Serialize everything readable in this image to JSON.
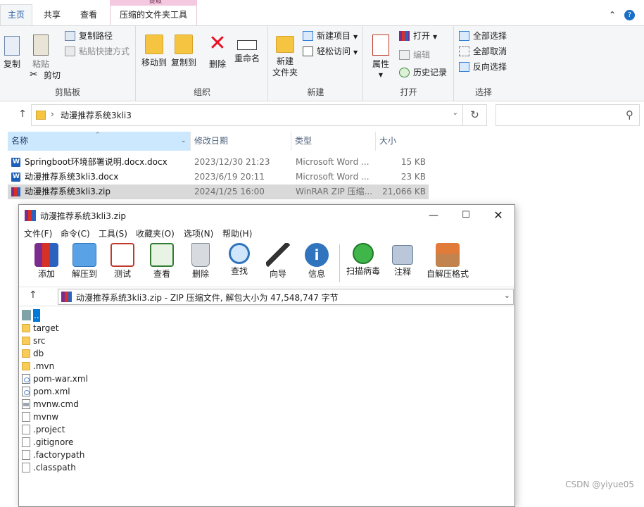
{
  "explorer": {
    "tabs": {
      "home": "主页",
      "share": "共享",
      "view": "查看",
      "context_group": "提取",
      "compressed_tools": "压缩的文件夹工具"
    },
    "ribbon": {
      "clipboard": {
        "label": "剪贴板",
        "copy": "复制",
        "paste": "粘贴",
        "copy_path": "复制路径",
        "paste_shortcut": "粘贴快捷方式",
        "cut": "剪切"
      },
      "organize": {
        "label": "组织",
        "move_to": "移动到",
        "copy_to": "复制到",
        "delete": "删除",
        "rename": "重命名"
      },
      "new": {
        "label": "新建",
        "new_folder_line1": "新建",
        "new_folder_line2": "文件夹",
        "new_item": "新建项目",
        "easy_access": "轻松访问"
      },
      "open": {
        "label": "打开",
        "properties": "属性",
        "open": "打开",
        "edit": "编辑",
        "history": "历史记录"
      },
      "select": {
        "label": "选择",
        "select_all": "全部选择",
        "select_none": "全部取消",
        "invert": "反向选择"
      }
    },
    "address": {
      "path": "动漫推荐系统3kli3"
    },
    "columns": {
      "name": "名称",
      "date": "修改日期",
      "type": "类型",
      "size": "大小"
    },
    "files": [
      {
        "name": "Springboot环境部署说明.docx.docx",
        "date": "2023/12/30 21:23",
        "type": "Microsoft Word ...",
        "size": "15 KB",
        "icon": "word-icon"
      },
      {
        "name": "动漫推荐系统3kli3.docx",
        "date": "2023/6/19 20:11",
        "type": "Microsoft Word ...",
        "size": "23 KB",
        "icon": "word-icon"
      },
      {
        "name": "动漫推荐系统3kli3.zip",
        "date": "2024/1/25 16:00",
        "type": "WinRAR ZIP 压缩...",
        "size": "21,066 KB",
        "icon": "winrar-icon"
      }
    ]
  },
  "winrar": {
    "title": "动漫推荐系统3kli3.zip",
    "menu": {
      "file": "文件(F)",
      "commands": "命令(C)",
      "tools": "工具(S)",
      "favorites": "收藏夹(O)",
      "options": "选项(N)",
      "help": "帮助(H)"
    },
    "toolbar": {
      "add": "添加",
      "extract_to": "解压到",
      "test": "测试",
      "view": "查看",
      "delete": "删除",
      "find": "查找",
      "wizard": "向导",
      "info": "信息",
      "virus_scan": "扫描病毒",
      "comment": "注释",
      "sfx": "自解压格式"
    },
    "path_text": "动漫推荐系统3kli3.zip - ZIP 压缩文件, 解包大小为 47,548,747 字节",
    "items": [
      {
        "name": "..",
        "kind": "updir"
      },
      {
        "name": "target",
        "kind": "folder"
      },
      {
        "name": "src",
        "kind": "folder"
      },
      {
        "name": "db",
        "kind": "folder"
      },
      {
        "name": ".mvn",
        "kind": "folder"
      },
      {
        "name": "pom-war.xml",
        "kind": "xml"
      },
      {
        "name": "pom.xml",
        "kind": "xml"
      },
      {
        "name": "mvnw.cmd",
        "kind": "cmd"
      },
      {
        "name": "mvnw",
        "kind": "plain"
      },
      {
        "name": ".project",
        "kind": "plain"
      },
      {
        "name": ".gitignore",
        "kind": "plain"
      },
      {
        "name": ".factorypath",
        "kind": "plain"
      },
      {
        "name": ".classpath",
        "kind": "plain"
      }
    ]
  },
  "watermark": "CSDN @yiyue05"
}
